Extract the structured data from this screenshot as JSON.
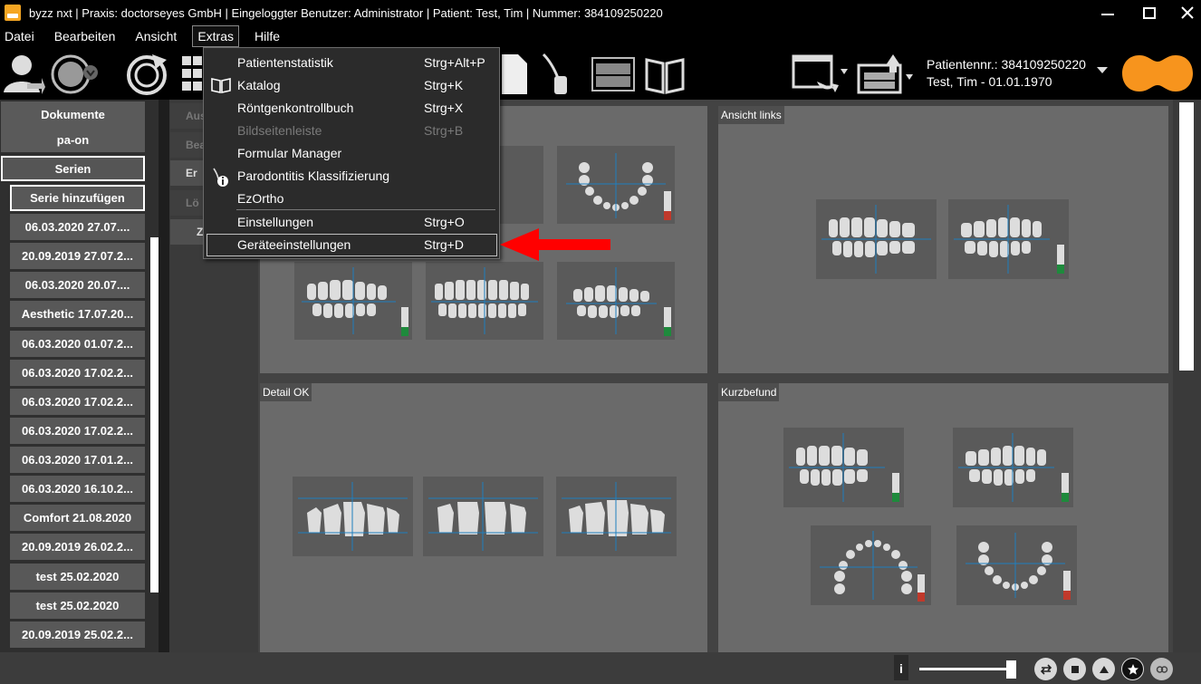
{
  "titlebar": {
    "title": "byzz nxt  |  Praxis: doctorseyes GmbH  |  Eingeloggter Benutzer: Administrator  |  Patient: Test, Tim   |  Nummer: 384109250220"
  },
  "menubar": {
    "items": [
      "Datei",
      "Bearbeiten",
      "Ansicht",
      "Extras",
      "Hilfe"
    ]
  },
  "patient": {
    "number_line": "Patientennr.: 384109250220",
    "name_line": "Test, Tim - 01.01.1970"
  },
  "leftpanel": {
    "buttons": [
      "Dokumente",
      "pa-on",
      "Serien"
    ],
    "add_series": "Serie hinzufügen",
    "series": [
      "06.03.2020 27.07....",
      "20.09.2019 27.07.2...",
      "06.03.2020 20.07....",
      "Aesthetic 17.07.20...",
      "06.03.2020 01.07.2...",
      "06.03.2020 17.02.2...",
      "06.03.2020 17.02.2...",
      "06.03.2020 17.02.2...",
      "06.03.2020 17.01.2...",
      "06.03.2020 16.10.2...",
      "Comfort 21.08.2020",
      "20.09.2019 26.02.2...",
      "test 25.02.2020",
      "test 25.02.2020",
      "20.09.2019 25.02.2..."
    ]
  },
  "midcol": {
    "tabs": [
      "Aus",
      "Bea",
      "Er",
      "Lö",
      "Z"
    ]
  },
  "panels": {
    "top_right": "Ansicht links",
    "bottom_left": "Detail OK",
    "bottom_right": "Kurzbefund"
  },
  "dropdown": {
    "items": [
      {
        "label": "Patientenstatistik",
        "shortcut": "Strg+Alt+P"
      },
      {
        "label": "Katalog",
        "shortcut": "Strg+K"
      },
      {
        "label": "Röntgenkontrollbuch",
        "shortcut": "Strg+X"
      },
      {
        "label": "Bildseitenleiste",
        "shortcut": "Strg+B"
      },
      {
        "label": "Formular Manager",
        "shortcut": ""
      },
      {
        "label": "Parodontitis Klassifizierung",
        "shortcut": ""
      },
      {
        "label": "EzOrtho",
        "shortcut": ""
      },
      {
        "label": "Einstellungen",
        "shortcut": "Strg+O"
      },
      {
        "label": "Geräteeinstellungen",
        "shortcut": "Strg+D"
      }
    ]
  },
  "statusbar": {
    "info": "i"
  },
  "colors": {
    "accent_orange": "#f7941d",
    "arrow_red": "#ff0000",
    "crosshair_blue": "#1f7fbf"
  }
}
